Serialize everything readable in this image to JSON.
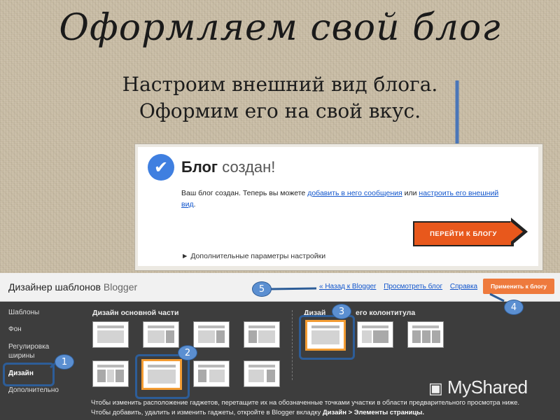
{
  "slide": {
    "title": "Оформляем свой блог",
    "subtitle_line1": "Настроим внешний вид блога.",
    "subtitle_line2": "Оформим его на свой вкус."
  },
  "card": {
    "heading_bold": "Блог",
    "heading_rest": "создан!",
    "text_prefix": "Ваш блог создан. Теперь вы можете",
    "link_add_posts": "добавить в него сообщения",
    "text_or": "или",
    "link_customize": "настроить его внешний вид",
    "go_button": "ПЕРЕЙТИ К БЛОГУ",
    "more_settings": "Дополнительные параметры настройки"
  },
  "designer": {
    "title": "Дизайнер шаблонов",
    "brand": "Blogger",
    "link_back": "« Назад к Blogger",
    "link_view": "Просмотреть блог",
    "link_help": "Справка",
    "apply_button": "Применить к блогу",
    "sidebar": [
      "Шаблоны",
      "Фон",
      "Регулировка ширины",
      "Дизайн",
      "Дополнительно"
    ],
    "active_item": "Дизайн",
    "section_main": "Дизайн основной части",
    "section_footer_left": "Дизай",
    "section_footer_right": "его колонтитула",
    "footer_line1": "Чтобы изменить расположение гаджетов, перетащите их на обозначенные точками участки в области предварительного просмотра ниже.",
    "footer_line2_prefix": "Чтобы добавить, удалить и изменить гаджеты, откройте в Blogger вкладку",
    "footer_line2_bold": "Дизайн > Элементы страницы."
  },
  "markers": [
    "1",
    "2",
    "3",
    "4",
    "5"
  ],
  "watermark": "MyShared",
  "colors": {
    "accent_orange": "#ee7a3d",
    "marker_blue": "#5b8fd1",
    "link_blue": "#1155cc"
  }
}
